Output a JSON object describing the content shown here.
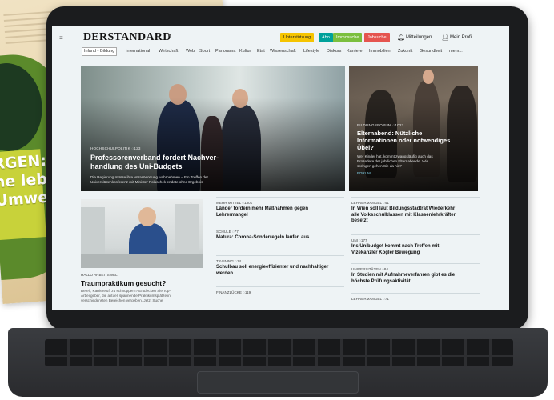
{
  "newspaper": {
    "banner_lines": [
      "RGEN:",
      "ne lebe",
      "Umwel"
    ]
  },
  "header": {
    "logo": "DERSTANDARD",
    "pills": [
      {
        "label": "Unterstützung",
        "color": "#f5c400"
      },
      {
        "label": "Abo",
        "color": "#00a19a"
      },
      {
        "label": "Immosuche",
        "color": "#7bbf3e"
      },
      {
        "label": "Jobsuche",
        "color": "#e5554f"
      }
    ],
    "notifications": "Mitteilungen",
    "profile": "Mein Profil",
    "icons": {
      "menu": "hamburger-menu-icon",
      "bell": "bell-icon",
      "user": "user-icon"
    }
  },
  "nav": {
    "items": [
      "Inland • Bildung",
      "International",
      "Wirtschaft",
      "Web",
      "Sport",
      "Panorama",
      "Kultur",
      "Etat",
      "Wissenschaft",
      "Lifestyle",
      "Diskurs",
      "Karriere",
      "Immobilien",
      "Zukunft",
      "Gesundheit",
      "mehr..."
    ]
  },
  "lead": {
    "kicker": "HOCHSCHULPOLITIK ◌123",
    "title_lines": [
      "Professorenverband fordert Nachver-",
      "handlung des Uni-Budgets"
    ],
    "teaser_lines": [
      "Die Regierung müsse ihre Verantwortung wahrnehmen – Ein Treffen der",
      "Universitätenkonferenz mit Minister Polaschek endete ohne Ergebnis"
    ]
  },
  "lead2": {
    "kicker": "BILDUNGSFORUM ◌1027",
    "title_lines": [
      "Elternabend: Nützliche",
      "Informationen oder notwendiges",
      "Übel?"
    ],
    "teaser_lines": [
      "Wer Kinder hat, kommt zwangsläufig auch das",
      "Prozedere der jährlichen Elternabende. Wie",
      "springen gehen Sie da hin?"
    ],
    "more": "FORUM"
  },
  "feature": {
    "kicker": "HALLO ARBEITSWELT",
    "title": "Traumpraktikum gesucht?",
    "teaser_lines": [
      "Bereit, Karriereluft zu schnuppern? Entdecken Sie Top-",
      "Arbeitgeber, die aktuell spannende Praktikumsplätze in",
      "verschiedensten Bereichen vergeben. Jetzt Suche"
    ]
  },
  "middle_col": [
    {
      "kicker": "MEHR MITTEL ◌1301",
      "title_lines": [
        "Länder fordern mehr Maßnahmen gegen",
        "Lehrermangel"
      ]
    },
    {
      "kicker": "SCHULE ◌77",
      "title_lines": [
        "Matura: Corona-Sonderregeln laufen aus"
      ]
    },
    {
      "kicker": "TRAINING ◌14",
      "title_lines": [
        "Schulbau soll energieeffizienter und nachhaltiger",
        "werden"
      ]
    },
    {
      "kicker": "FINANZLÜCKE ◌119",
      "title_lines": [
        ""
      ]
    }
  ],
  "right_col": [
    {
      "kicker": "LEHRERMANGEL ◌41",
      "title_lines": [
        "In Wien soll laut Bildungsstadtrat Wiederkehr",
        "alle Volksschulklassen mit Klassenlehrkräften",
        "besetzt"
      ]
    },
    {
      "kicker": "UNI ◌177",
      "title_lines": [
        "Ins Unibudget kommt nach Treffen mit",
        "Vizekanzler Kogler Bewegung"
      ]
    },
    {
      "kicker": "UNIVERSITÄTEN ◌84",
      "title_lines": [
        "In Studien mit Aufnahmeverfahren gibt es die",
        "höchste Prüfungsaktivität"
      ]
    },
    {
      "kicker": "LEHRERMANGEL ◌71",
      "title_lines": [
        ""
      ]
    }
  ]
}
